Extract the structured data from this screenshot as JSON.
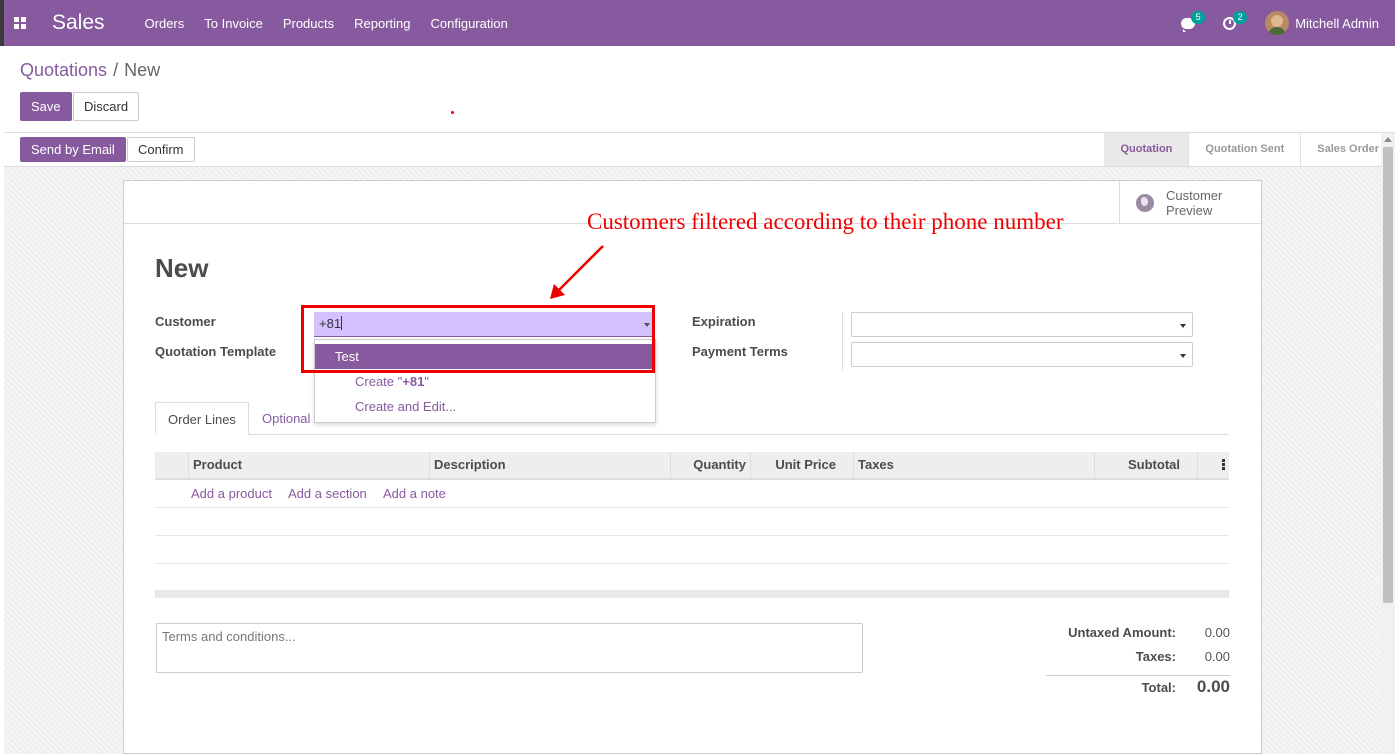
{
  "navbar": {
    "app_name": "Sales",
    "menu": [
      "Orders",
      "To Invoice",
      "Products",
      "Reporting",
      "Configuration"
    ],
    "messages_count": "5",
    "activities_count": "2",
    "user_name": "Mitchell Admin",
    "brand_color": "#875a9f"
  },
  "breadcrumb": {
    "parent": "Quotations",
    "separator": "/",
    "current": "New"
  },
  "actions": {
    "save": "Save",
    "discard": "Discard"
  },
  "statusbar": {
    "send_email": "Send by Email",
    "confirm": "Confirm",
    "steps": [
      "Quotation",
      "Quotation Sent",
      "Sales Order"
    ],
    "active_step": "Quotation"
  },
  "smart_button": {
    "label_line1": "Customer",
    "label_line2": "Preview"
  },
  "annotation": "Customers filtered according to their phone number",
  "form": {
    "title": "New",
    "customer_label": "Customer",
    "customer_value": "+81",
    "template_label": "Quotation Template",
    "expiration_label": "Expiration",
    "payment_terms_label": "Payment Terms"
  },
  "autocomplete": {
    "result": "Test",
    "create_prefix": "Create \"",
    "create_term": "+81",
    "create_suffix": "\"",
    "create_edit": "Create and Edit..."
  },
  "tabs": [
    "Order Lines",
    "Optional"
  ],
  "table": {
    "headers": [
      "Product",
      "Description",
      "Quantity",
      "Unit Price",
      "Taxes",
      "Subtotal"
    ],
    "add_product": "Add a product",
    "add_section": "Add a section",
    "add_note": "Add a note"
  },
  "terms_placeholder": "Terms and conditions...",
  "totals": {
    "untaxed_label": "Untaxed Amount:",
    "untaxed_value": "0.00",
    "taxes_label": "Taxes:",
    "taxes_value": "0.00",
    "total_label": "Total:",
    "total_value": "0.00"
  }
}
